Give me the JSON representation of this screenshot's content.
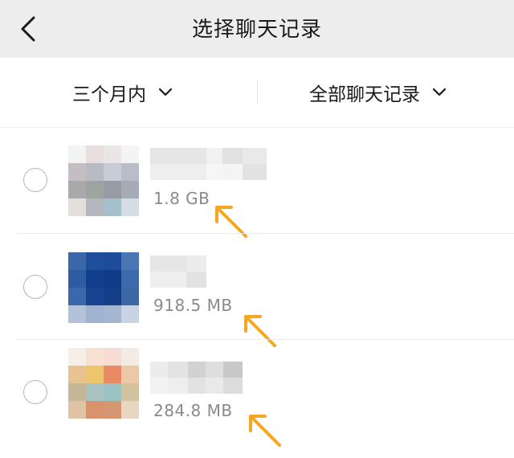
{
  "header": {
    "title": "选择聊天记录",
    "back_icon": "chevron-left-icon"
  },
  "filters": {
    "time_range": {
      "label": "三个月内",
      "icon": "chevron-down-icon"
    },
    "scope": {
      "label": "全部聊天记录",
      "icon": "chevron-down-icon"
    }
  },
  "chats": [
    {
      "size": "1.8 GB",
      "selected": false
    },
    {
      "size": "918.5 MB",
      "selected": false
    },
    {
      "size": "284.8 MB",
      "selected": false
    }
  ],
  "colors": {
    "arrow": "#f5a623",
    "header_bg": "#ededed",
    "size_text": "#8a8a8a"
  }
}
